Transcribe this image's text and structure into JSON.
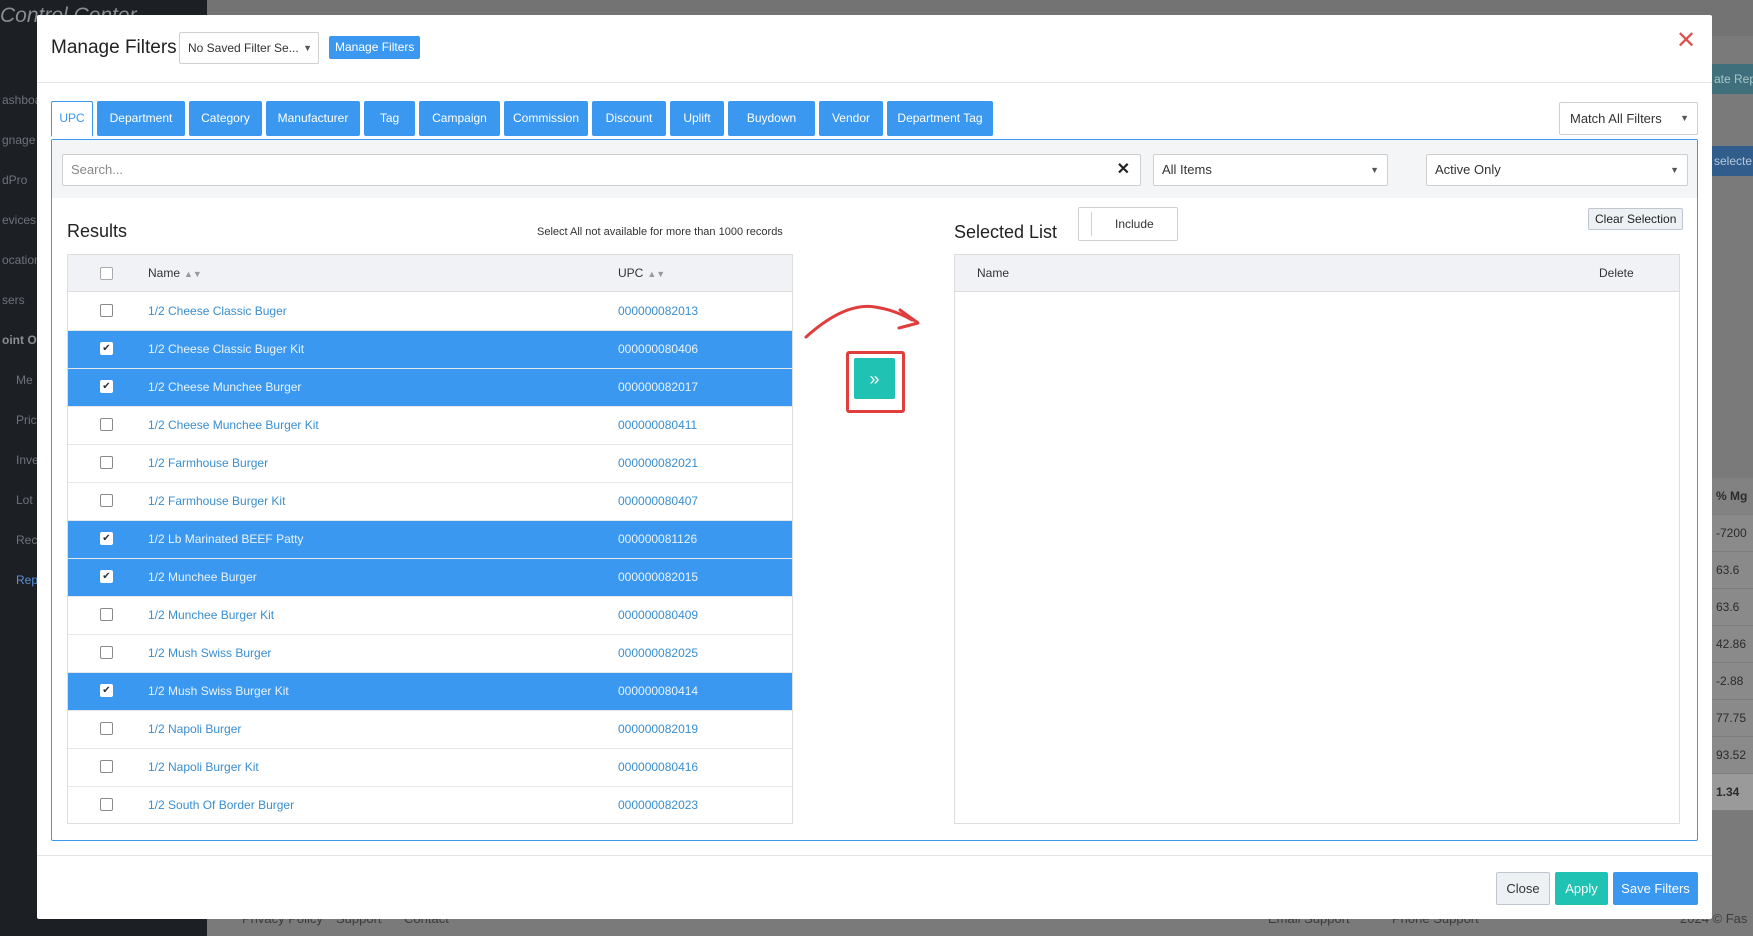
{
  "background": {
    "brand": "Control Center",
    "nav": [
      "ashboard",
      "gnage",
      "dPro",
      "evices",
      "ocations",
      "sers",
      "oint Of",
      "Me",
      "Pric",
      "Inve",
      "Lot",
      "Rec",
      "Rep"
    ],
    "right_btn_1": "ate Rep",
    "right_btn_2": "selecte",
    "col_header": "% Mg",
    "col_values": [
      "-7200",
      "63.6",
      "63.6",
      "42.86",
      "-2.88",
      "77.75",
      "93.52"
    ],
    "col_total": "1.34",
    "footer": {
      "privacy": "Privacy Policy",
      "support": "Support",
      "contact": "Contact",
      "email": "Email Support",
      "phone": "Phone Support",
      "copyright": "2024 © Fas"
    }
  },
  "modal": {
    "title": "Manage Filters",
    "saved_filter": "No Saved Filter Se...",
    "manage_filters_btn": "Manage Filters",
    "tabs": [
      "UPC",
      "Department",
      "Category",
      "Manufacturer",
      "Tag",
      "Campaign",
      "Commission",
      "Discount",
      "Uplift",
      "Buydown",
      "Vendor",
      "Department Tag"
    ],
    "match_mode": "Match All Filters",
    "search_placeholder": "Search...",
    "items_filter": "All Items",
    "status_filter": "Active Only",
    "results_title": "Results",
    "results_note": "Select All not available for more than 1000 records",
    "col_name": "Name",
    "col_upc": "UPC",
    "rows": [
      {
        "name": "1/2 Cheese Classic Buger",
        "upc": "000000082013",
        "selected": false
      },
      {
        "name": "1/2 Cheese Classic Buger Kit",
        "upc": "000000080406",
        "selected": true
      },
      {
        "name": "1/2 Cheese Munchee Burger",
        "upc": "000000082017",
        "selected": true
      },
      {
        "name": "1/2 Cheese Munchee Burger Kit",
        "upc": "000000080411",
        "selected": false
      },
      {
        "name": "1/2 Farmhouse Burger",
        "upc": "000000082021",
        "selected": false
      },
      {
        "name": "1/2 Farmhouse Burger Kit",
        "upc": "000000080407",
        "selected": false
      },
      {
        "name": "1/2 Lb Marinated BEEF Patty",
        "upc": "000000081126",
        "selected": true
      },
      {
        "name": "1/2 Munchee Burger",
        "upc": "000000082015",
        "selected": true
      },
      {
        "name": "1/2 Munchee Burger Kit",
        "upc": "000000080409",
        "selected": false
      },
      {
        "name": "1/2 Mush Swiss Burger",
        "upc": "000000082025",
        "selected": false
      },
      {
        "name": "1/2 Mush Swiss Burger Kit",
        "upc": "000000080414",
        "selected": true
      },
      {
        "name": "1/2 Napoli Burger",
        "upc": "000000082019",
        "selected": false
      },
      {
        "name": "1/2 Napoli Burger Kit",
        "upc": "000000080416",
        "selected": false
      },
      {
        "name": "1/2 South Of Border Burger",
        "upc": "000000082023",
        "selected": false
      }
    ],
    "selected_title": "Selected List",
    "include_label": "Include",
    "clear_selection": "Clear Selection",
    "sel_col_name": "Name",
    "sel_col_delete": "Delete",
    "btn_close": "Close",
    "btn_apply": "Apply",
    "btn_save": "Save Filters",
    "colors": {
      "accent": "#3a98f0",
      "teal": "#1fc2b3",
      "danger": "#e03d3d"
    }
  }
}
